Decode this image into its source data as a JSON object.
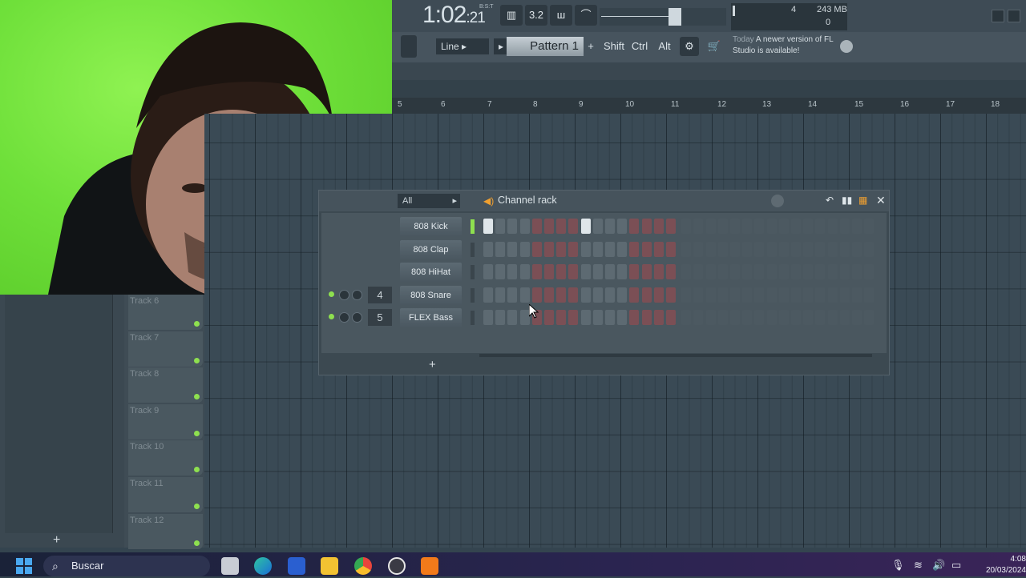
{
  "toolbar": {
    "time_main": "1:02",
    "time_small": ":21",
    "time_unit": "B:S:T",
    "tempo_label": "3.2",
    "meter_cpu": "4",
    "meter_mem": "243 MB",
    "meter_poly": "0",
    "record_mode": "Line",
    "pattern": "Pattern 1",
    "key_shift": "Shift",
    "key_ctrl": "Ctrl",
    "key_alt": "Alt",
    "hint_date": "Today",
    "hint_text": "A newer version of FL Studio is available!"
  },
  "ruler": [
    "5",
    "6",
    "7",
    "8",
    "9",
    "10",
    "11",
    "12",
    "13",
    "14",
    "15",
    "16",
    "17",
    "18"
  ],
  "tracks": [
    "Track 6",
    "Track 7",
    "Track 8",
    "Track 9",
    "Track 10",
    "Track 11",
    "Track 12"
  ],
  "channel_rack": {
    "filter": "All",
    "title": "Channel rack",
    "channels": [
      {
        "num": "",
        "name": "808 Kick",
        "selected": true,
        "steps_on": [
          0,
          8
        ]
      },
      {
        "num": "",
        "name": "808 Clap",
        "selected": false,
        "steps_on": []
      },
      {
        "num": "",
        "name": "808 HiHat",
        "selected": false,
        "steps_on": []
      },
      {
        "num": "4",
        "name": "808 Snare",
        "selected": false,
        "steps_on": []
      },
      {
        "num": "5",
        "name": "FLEX Bass",
        "selected": false,
        "steps_on": []
      }
    ],
    "add_label": "+"
  },
  "left_pane": {
    "add_label": "+"
  },
  "taskbar": {
    "search_placeholder": "Buscar",
    "time": "4:08",
    "date": "20/03/2024"
  }
}
